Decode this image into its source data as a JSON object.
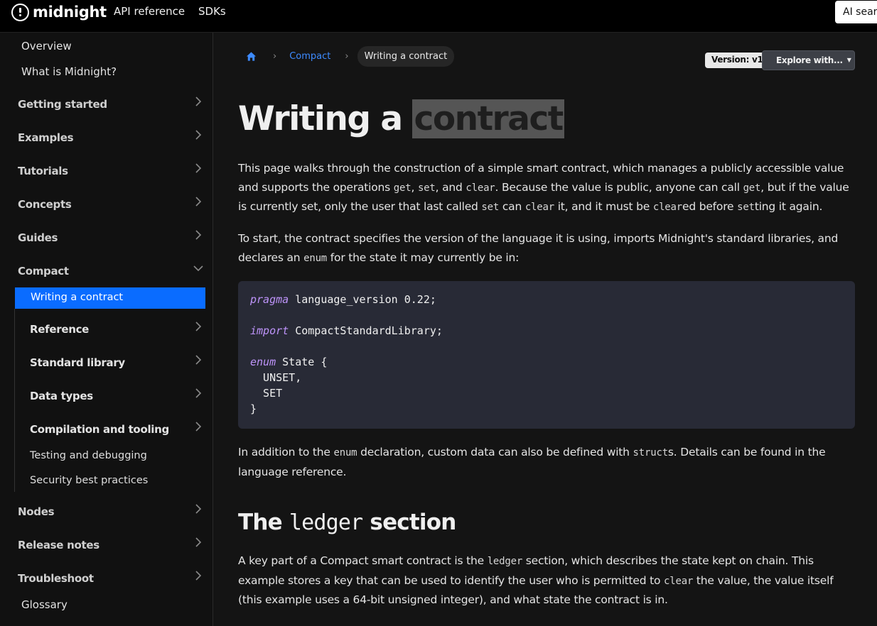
{
  "header": {
    "logo_text": "midnight",
    "nav": [
      "API reference",
      "SDKs"
    ],
    "ai_search_label": "AI search"
  },
  "sidebar": {
    "top_links": [
      "Overview",
      "What is Midnight?"
    ],
    "categories_before": [
      "Getting started",
      "Examples",
      "Tutorials",
      "Concepts",
      "Guides"
    ],
    "compact": {
      "label": "Compact",
      "active_item": "Writing a contract",
      "subcategories": [
        "Reference",
        "Standard library",
        "Data types",
        "Compilation and tooling"
      ],
      "sub_links": [
        "Testing and debugging",
        "Security best practices"
      ]
    },
    "categories_after": [
      "Nodes",
      "Release notes",
      "Troubleshoot"
    ],
    "bottom_links": [
      "Glossary"
    ]
  },
  "breadcrumb": {
    "home_icon": "home-icon",
    "section": "Compact",
    "current": "Writing a contract"
  },
  "toolbar": {
    "version": "Version: v1",
    "explore": "Explore with..."
  },
  "page": {
    "title_main": "Writing a",
    "title_highlight": "contract",
    "para1": {
      "t1": "This page walks through the construction of a simple smart contract, which manages a publicly accessible value and supports the operations ",
      "c1": "get",
      "t2": ", ",
      "c2": "set",
      "t3": ", and ",
      "c3": "clear",
      "t4": ". Because the value is public, anyone can call ",
      "c4": "get",
      "t5": ", but if the value is currently set, only the user that last called ",
      "c5": "set",
      "t6": " can ",
      "c6": "clear",
      "t7": " it, and it must be ",
      "c7": "clear",
      "t8": "ed before ",
      "c8": "set",
      "t9": "ting it again."
    },
    "para2": {
      "t1": "To start, the contract specifies the version of the language it is using, imports Midnight's standard libraries, and declares an ",
      "c1": "enum",
      "t2": " for the state it may currently be in:"
    },
    "code": {
      "line1_kw": "pragma",
      "line1_rest": " language_version 0.22;",
      "line2_kw": "import",
      "line2_rest": " CompactStandardLibrary;",
      "line3_kw": "enum",
      "line3_rest": " State {",
      "line4": "  UNSET,",
      "line5": "  SET",
      "line6": "}"
    },
    "para3": {
      "t1": "In addition to the ",
      "c1": "enum",
      "t2": " declaration, custom data can also be defined with ",
      "c2": "struct",
      "t3": "s. Details can be found in the language reference."
    },
    "section_title": {
      "pre": "The ",
      "code": "ledger",
      "post": " section"
    },
    "para4": {
      "t1": "A key part of a Compact smart contract is the ",
      "c1": "ledger",
      "t2": " section, which describes the state kept on chain. This example stores a key that can be used to identify the user who is permitted to ",
      "c2": "clear",
      "t3": " the value, the value itself (this example uses a 64-bit unsigned integer), and what state the contract is in."
    }
  }
}
